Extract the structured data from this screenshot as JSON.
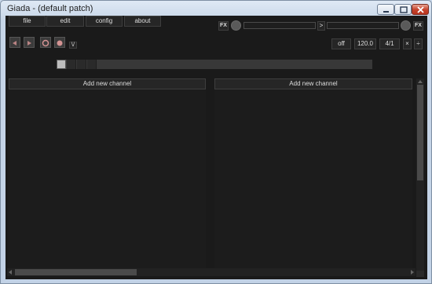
{
  "window": {
    "title": "Giada - (default patch)"
  },
  "menu": {
    "items": [
      "file",
      "edit",
      "config",
      "about"
    ]
  },
  "mixer": {
    "fx_in_label": "FX",
    "fx_out_label": "FX",
    "separator_label": ">"
  },
  "transport": {
    "metronome_label": "\\/"
  },
  "timing": {
    "quantize": "off",
    "bpm": "120.0",
    "beats": "4/1",
    "multiply_label": "×",
    "divide_label": "÷"
  },
  "beat_meter": {
    "beats": 4,
    "current_beat": 1
  },
  "columns": [
    {
      "add_label": "Add new channel"
    },
    {
      "add_label": "Add new channel"
    }
  ],
  "colors": {
    "background": "#1a1a1a",
    "control": "#262626",
    "border": "#3e3e3e",
    "text": "#dedede",
    "record": "#d49393",
    "play": "#b98484"
  }
}
